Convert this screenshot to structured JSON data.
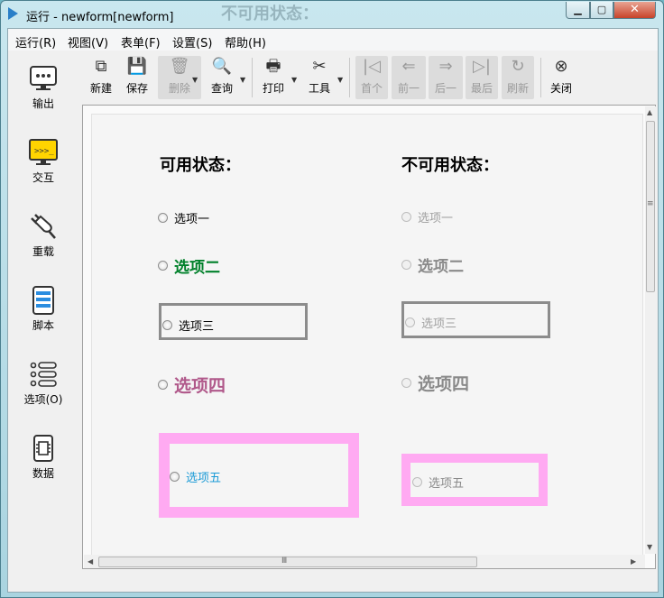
{
  "window": {
    "title": "运行 - newform[newform]",
    "ghost_title": "不可用状态：",
    "controls": {
      "minimize": "▁",
      "maximize": "▢",
      "close": "✕"
    }
  },
  "menu": [
    {
      "label": "运行(R)"
    },
    {
      "label": "视图(V)"
    },
    {
      "label": "表单(F)"
    },
    {
      "label": "设置(S)"
    },
    {
      "label": "帮助(H)"
    }
  ],
  "sidebar": [
    {
      "label": "输出",
      "icon": "monitor-icon"
    },
    {
      "label": "交互",
      "icon": "terminal-icon"
    },
    {
      "label": "重载",
      "icon": "plug-icon"
    },
    {
      "label": "脚本",
      "icon": "script-icon"
    },
    {
      "label": "选项(O)",
      "icon": "options-list-icon"
    },
    {
      "label": "数据",
      "icon": "chip-icon"
    }
  ],
  "toolbar": [
    {
      "label": "新建",
      "glyph": "⧉",
      "enabled": true
    },
    {
      "label": "保存",
      "glyph": "💾",
      "enabled": true
    },
    {
      "label": "删除",
      "glyph": "🗑",
      "enabled": false
    },
    {
      "label": "查询",
      "glyph": "🔍",
      "enabled": true
    },
    {
      "label": "打印",
      "glyph": "🖶",
      "enabled": true
    },
    {
      "label": "工具",
      "glyph": "✂",
      "enabled": true
    },
    {
      "label": "首个",
      "glyph": "|◁",
      "enabled": false
    },
    {
      "label": "前一",
      "glyph": "⇐",
      "enabled": false
    },
    {
      "label": "后一",
      "glyph": "⇒",
      "enabled": false
    },
    {
      "label": "最后",
      "glyph": "▷|",
      "enabled": false
    },
    {
      "label": "刷新",
      "glyph": "↻",
      "enabled": false
    },
    {
      "label": "关闭",
      "glyph": "⊗",
      "enabled": true
    }
  ],
  "form": {
    "enabled_heading": "可用状态：",
    "disabled_heading": "不可用状态：",
    "enabled_options": [
      {
        "label": "选项一",
        "color": "#000000"
      },
      {
        "label": "选项二",
        "color": "#00802a"
      },
      {
        "label": "选项三",
        "color": "#000000"
      },
      {
        "label": "选项四",
        "color": "#b0588a"
      },
      {
        "label": "选项五",
        "color": "#1a9ad6"
      }
    ],
    "disabled_options": [
      {
        "label": "选项一",
        "color": "#a0a0a0"
      },
      {
        "label": "选项二",
        "color": "#8a8a8a"
      },
      {
        "label": "选项三",
        "color": "#a0a0a0"
      },
      {
        "label": "选项四",
        "color": "#8a8a8a"
      },
      {
        "label": "选项五",
        "color": "#8a8a8a"
      }
    ],
    "frame_colors": {
      "grey": "#8c8c8c",
      "pink": "#ffaaf2"
    }
  },
  "scrollbar": {
    "grip": "≡",
    "hgrip": "Ⅲ"
  }
}
